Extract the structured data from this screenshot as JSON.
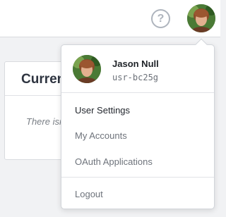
{
  "header": {
    "help_icon": "question-circle-icon",
    "help_glyph": "?",
    "avatar_icon": "user-avatar"
  },
  "background_card": {
    "title": "Curren",
    "empty_text": "There isn"
  },
  "user_menu": {
    "user_name": "Jason Null",
    "user_id": "usr-bc25g",
    "items": [
      {
        "label": "User Settings",
        "active": true
      },
      {
        "label": "My Accounts",
        "active": false
      },
      {
        "label": "OAuth Applications",
        "active": false
      }
    ],
    "logout_label": "Logout"
  },
  "colors": {
    "background": "#f1f2f4",
    "surface": "#ffffff",
    "muted_text": "#6e737b",
    "icon_gray": "#aeb4bd"
  }
}
